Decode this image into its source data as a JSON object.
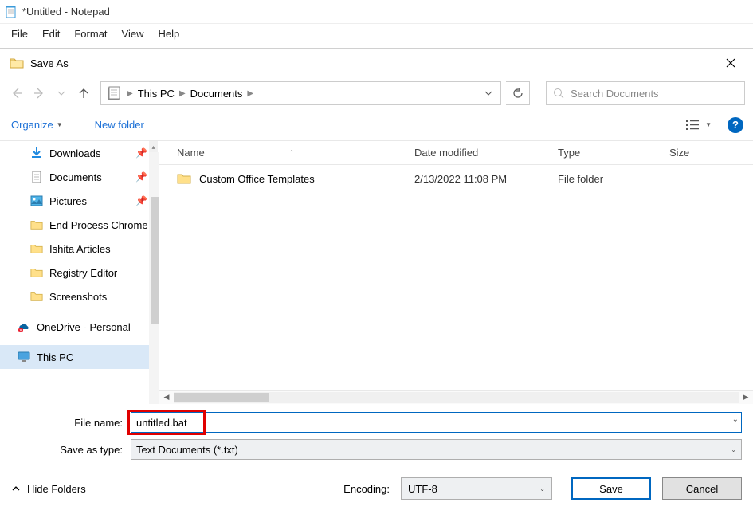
{
  "notepad": {
    "title": "*Untitled - Notepad",
    "menu": {
      "file": "File",
      "edit": "Edit",
      "format": "Format",
      "view": "View",
      "help": "Help"
    }
  },
  "dialog": {
    "title": "Save As",
    "breadcrumb": {
      "root": "This PC",
      "folder": "Documents"
    },
    "search_placeholder": "Search Documents",
    "toolbar": {
      "organize": "Organize",
      "new_folder": "New folder"
    },
    "columns": {
      "name": "Name",
      "date": "Date modified",
      "type": "Type",
      "size": "Size"
    },
    "sidebar": [
      {
        "icon": "download",
        "label": "Downloads",
        "pinned": true
      },
      {
        "icon": "document",
        "label": "Documents",
        "pinned": true
      },
      {
        "icon": "pictures",
        "label": "Pictures",
        "pinned": true
      },
      {
        "icon": "folder",
        "label": "End Process Chrome",
        "pinned": false
      },
      {
        "icon": "folder",
        "label": "Ishita Articles",
        "pinned": false
      },
      {
        "icon": "folder",
        "label": "Registry Editor",
        "pinned": false
      },
      {
        "icon": "folder",
        "label": "Screenshots",
        "pinned": false
      },
      {
        "icon": "onedrive",
        "label": "OneDrive - Personal",
        "pinned": false
      },
      {
        "icon": "thispc",
        "label": "This PC",
        "pinned": false,
        "selected": true
      }
    ],
    "files": [
      {
        "name": "Custom Office Templates",
        "date": "2/13/2022 11:08 PM",
        "type": "File folder"
      }
    ],
    "form": {
      "filename_label": "File name:",
      "filename_value": "untitled.bat",
      "saveastype_label": "Save as type:",
      "saveastype_value": "Text Documents (*.txt)",
      "hide_folders": "Hide Folders",
      "encoding_label": "Encoding:",
      "encoding_value": "UTF-8",
      "save": "Save",
      "cancel": "Cancel"
    }
  }
}
